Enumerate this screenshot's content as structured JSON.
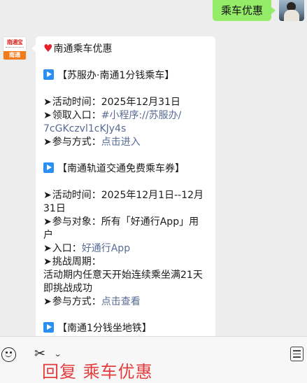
{
  "outgoing": {
    "text": "乘车优惠"
  },
  "bot_avatar": {
    "brand_top": "南通宝",
    "brand_bottom": "南通"
  },
  "message": {
    "title": "南通乘车优惠",
    "sections": [
      {
        "heading": "【苏服办·南通1分钱乘车】",
        "lines": [
          {
            "label": "活动时间：",
            "value": "2025年12月31日"
          },
          {
            "label": "领取入口：",
            "link": "#小程序://苏服办/",
            "link2": "7cGKczvl1cKJy4s"
          },
          {
            "label": "参与方式：",
            "link": "点击进入"
          }
        ]
      },
      {
        "heading": "【南通轨道交通免费乘车券】",
        "lines": [
          {
            "label": "活动时间：",
            "value": "2025年12月1日--12月",
            "value2": "31日"
          },
          {
            "label": "参与对象：",
            "value": "所有「好通行App」用",
            "value2": "户"
          },
          {
            "label": "入口：",
            "link": "好通行App"
          },
          {
            "label": "挑战周期：",
            "value2": "活动期内任意天开始连续乘坐满21天",
            "value3": "即挑战成功"
          },
          {
            "label": "参与方式：",
            "link": "点击查看"
          }
        ]
      },
      {
        "heading": "【南通1分钱坐地铁】"
      }
    ]
  },
  "inputbar": {
    "reply_text": "回复 乘车优惠",
    "icons": [
      "emoji-icon",
      "scissors-icon",
      "chevron-down-icon",
      "menu-icon"
    ]
  },
  "colors": {
    "outgoing_bubble": "#95ec69",
    "link": "#576b95",
    "heart": "#e3202c",
    "play_badge": "#2a8ef5",
    "reply_text": "#e33c3c"
  }
}
